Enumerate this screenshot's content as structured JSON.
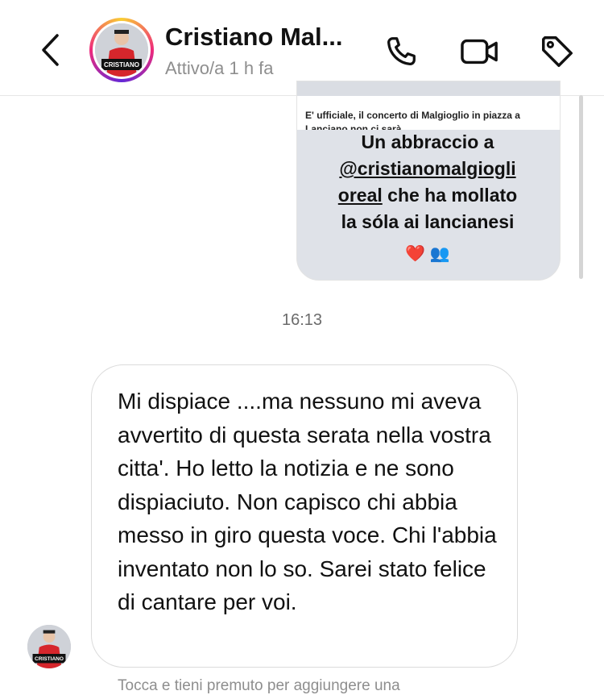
{
  "header": {
    "contact_name": "Cristiano Mal...",
    "status": "Attivo/a 1 h fa",
    "avatar_caption": "CRISTIANO",
    "back_icon": "chevron-left-icon",
    "call_icon": "phone-icon",
    "video_icon": "video-camera-icon",
    "tag_icon": "tag-icon"
  },
  "shared_story": {
    "news_text": "E' ufficiale, il concerto di Malgioglio in piazza a Lanciano non ci sarà.",
    "line1": "Un abbraccio a",
    "mention_part1": "@cristianomalgiogli",
    "mention_part2": "oreal",
    "line3_rest": " che ha mollato",
    "line4": "la sóla ai lancianesi",
    "emojis": "❤️ 👥"
  },
  "timestamp": "16:13",
  "message": {
    "text": "Mi dispiace ....ma nessuno mi aveva avvertito di questa serata nella vostra citta'. Ho letto la notizia e ne sono dispiaciuto. Non capisco chi abbia messo in giro questa voce. Chi l'abbia inventato non lo so. Sarei stato felice di cantare per voi."
  },
  "hint": "Tocca e tieni premuto per aggiungere una",
  "colors": {
    "accent_gradient": [
      "#f9ce34",
      "#ee2a7b",
      "#6228d7"
    ],
    "status_gray": "#8e8e8e",
    "bubble_border": "#dbdbdb"
  }
}
